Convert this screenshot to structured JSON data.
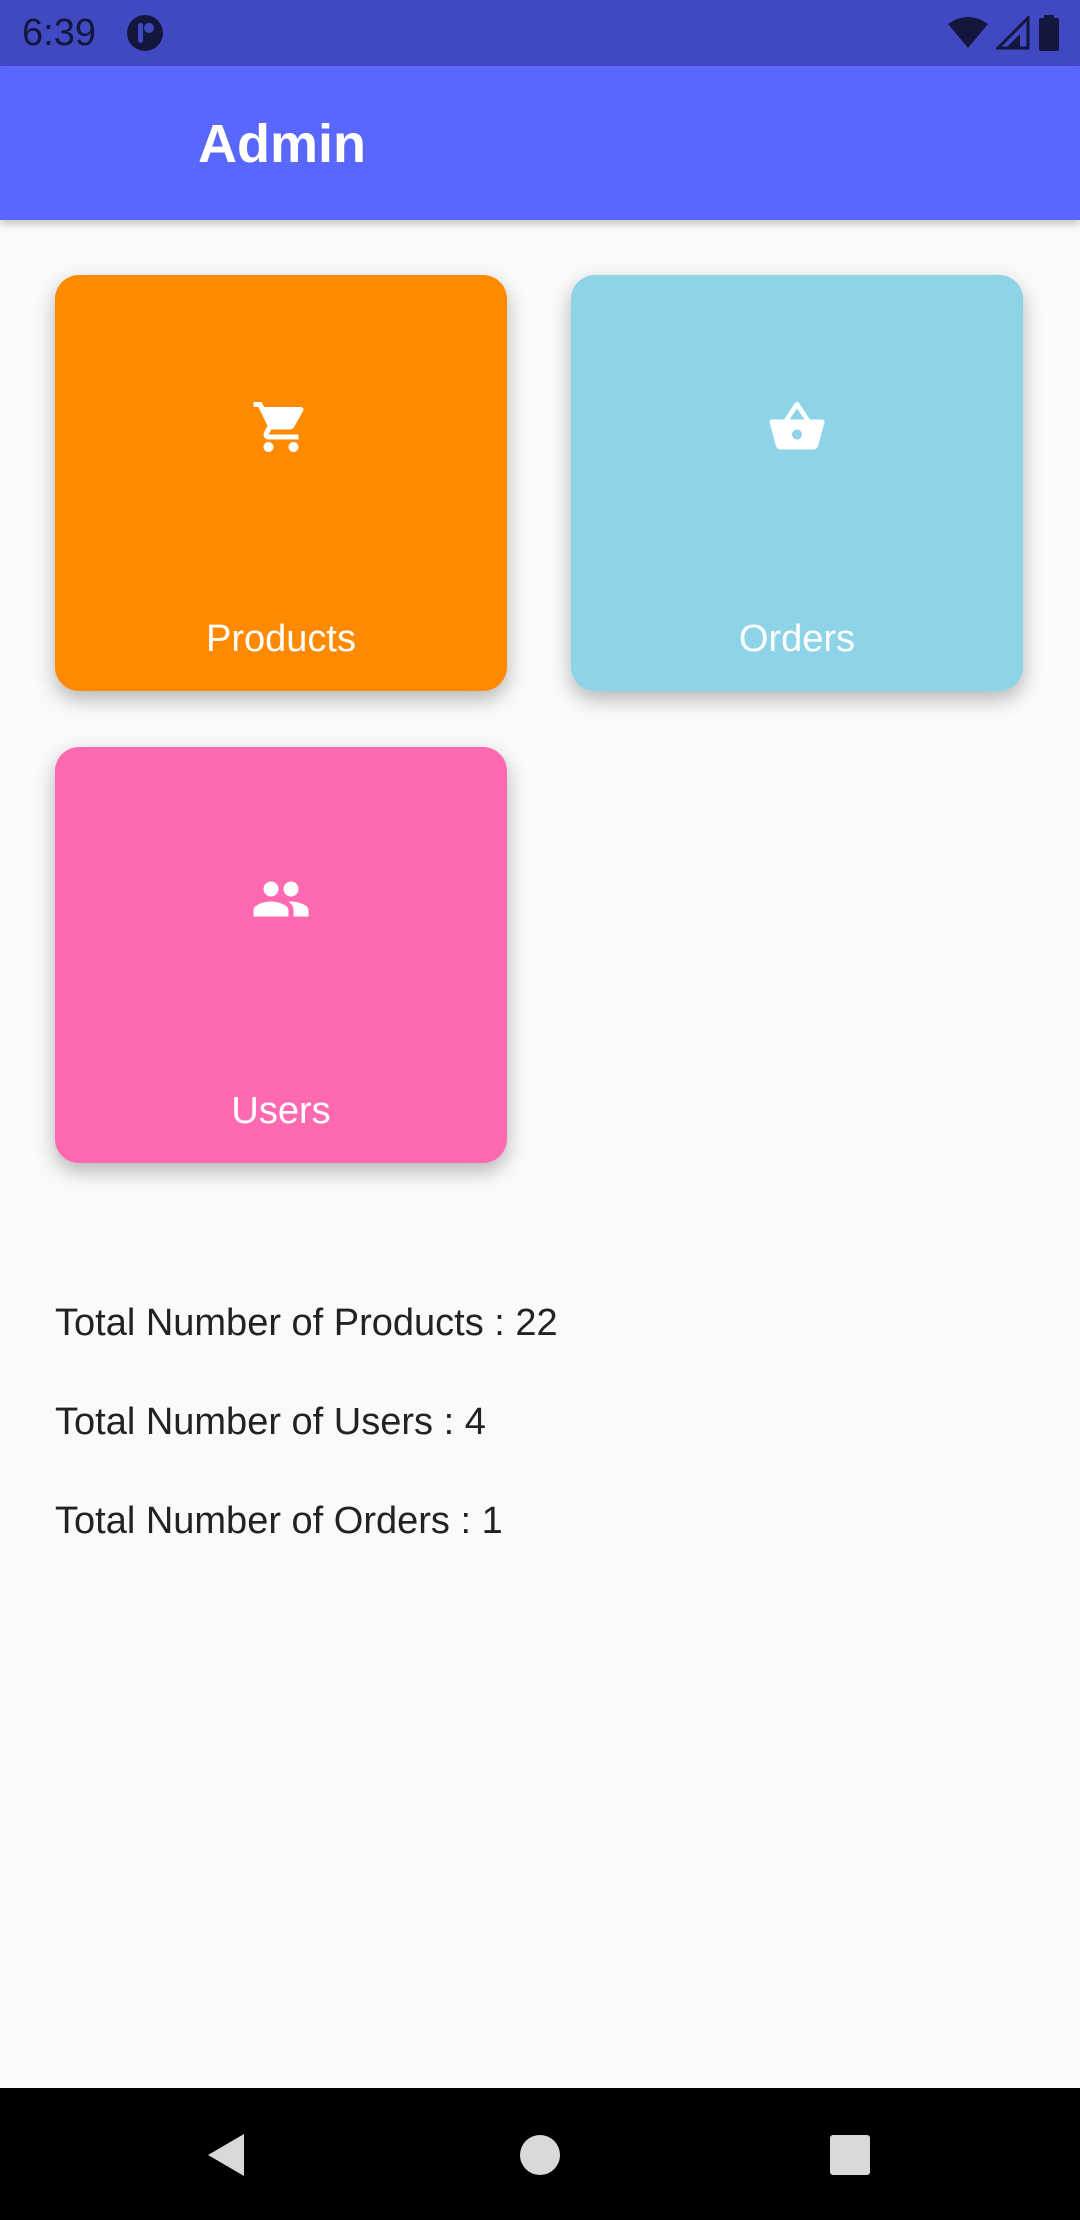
{
  "status_bar": {
    "time": "6:39",
    "icons": [
      "notification-app-icon",
      "wifi-icon",
      "signal-icon",
      "battery-icon"
    ]
  },
  "app_bar": {
    "title": "Admin",
    "background_color": "#5a67ff"
  },
  "tiles": [
    {
      "label": "Products",
      "icon": "shopping-cart-icon",
      "color": "#ff8a00"
    },
    {
      "label": "Orders",
      "icon": "basket-icon",
      "color": "#8dd4e8"
    },
    {
      "label": "Users",
      "icon": "users-icon",
      "color": "#ff69b0"
    }
  ],
  "stats": {
    "products": "Total Number of Products : 22",
    "users": "Total Number of Users : 4",
    "orders": "Total Number of Orders : 1"
  },
  "nav_bar": {
    "buttons": [
      "back-icon",
      "home-icon",
      "recent-apps-icon"
    ]
  }
}
